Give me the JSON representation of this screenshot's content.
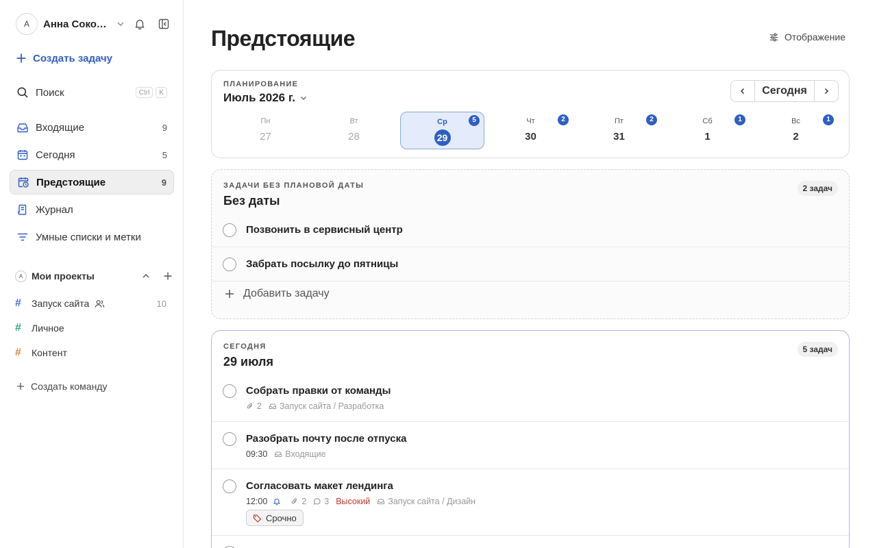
{
  "sidebar": {
    "user": {
      "initial": "А",
      "name": "Анна Соколова"
    },
    "create_task": "Создать задачу",
    "search": {
      "label": "Поиск",
      "kbd1": "Ctrl",
      "kbd2": "K"
    },
    "nav": [
      {
        "label": "Входящие",
        "count": "9"
      },
      {
        "label": "Сегодня",
        "count": "5"
      },
      {
        "label": "Предстоящие",
        "count": "9"
      },
      {
        "label": "Журнал",
        "count": ""
      },
      {
        "label": "Умные списки и метки",
        "count": ""
      }
    ],
    "projects_header": {
      "initial": "А",
      "label": "Мои проекты"
    },
    "projects": [
      {
        "label": "Запуск сайта",
        "count": "10",
        "color": "#4a6fd8"
      },
      {
        "label": "Личное",
        "count": "",
        "color": "#2eaa7a"
      },
      {
        "label": "Контент",
        "count": "",
        "color": "#d98a3a"
      }
    ],
    "create_team": "Создать команду"
  },
  "main": {
    "title": "Предстоящие",
    "display_button": "Отображение",
    "planning": {
      "caption": "ПЛАНИРОВАНИЕ",
      "month": "Июль 2026 г.",
      "today_button": "Сегодня",
      "days": [
        {
          "name": "Пн",
          "num": "27",
          "badge": ""
        },
        {
          "name": "Вт",
          "num": "28",
          "badge": ""
        },
        {
          "name": "Ср",
          "num": "29",
          "badge": "5"
        },
        {
          "name": "Чт",
          "num": "30",
          "badge": "2"
        },
        {
          "name": "Пт",
          "num": "31",
          "badge": "2"
        },
        {
          "name": "Сб",
          "num": "1",
          "badge": "1"
        },
        {
          "name": "Вс",
          "num": "2",
          "badge": "1"
        }
      ]
    },
    "no_date": {
      "caption": "ЗАДАЧИ БЕЗ ПЛАНОВОЙ ДАТЫ",
      "title": "Без даты",
      "count": "2 задач",
      "tasks": [
        {
          "title": "Позвонить в сервисный центр"
        },
        {
          "title": "Забрать посылку до пятницы"
        }
      ],
      "add_task": "Добавить задачу"
    },
    "today": {
      "caption": "СЕГОДНЯ",
      "title": "29 июля",
      "count": "5 задач",
      "tasks": [
        {
          "title": "Собрать правки от команды",
          "attachments": "2",
          "project": "Запуск сайта / Разработка"
        },
        {
          "title": "Разобрать почту после отпуска",
          "time": "09:30",
          "project": "Входящие"
        },
        {
          "title": "Согласовать макет лендинга",
          "time": "12:00",
          "attachments": "2",
          "comments": "3",
          "priority": "Высокий",
          "project": "Запуск сайта / Дизайн",
          "tag": "Срочно"
        }
      ]
    }
  }
}
